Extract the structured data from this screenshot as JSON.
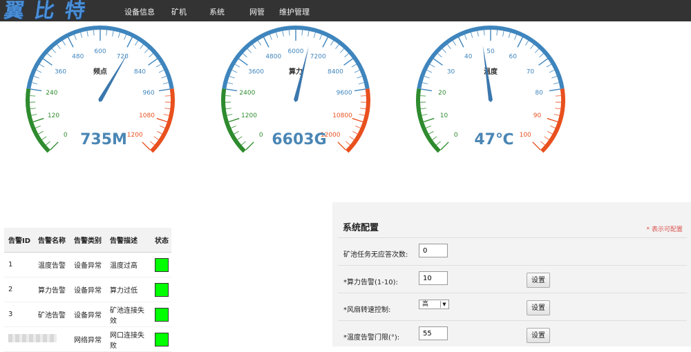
{
  "header": {
    "logo": "翼比特",
    "nav": [
      "设备信息",
      "矿机",
      "系统",
      "网管",
      "维护管理"
    ]
  },
  "gauges": [
    {
      "title": "频点",
      "value": 735,
      "value_label": "735M",
      "min": 0,
      "max": 1200,
      "ticks": [
        "0",
        "120",
        "240",
        "360",
        "480",
        "600",
        "720",
        "840",
        "960",
        "1080",
        "1200"
      ]
    },
    {
      "title": "算力",
      "value": 6603,
      "value_label": "6603G",
      "min": 0,
      "max": 12000,
      "ticks": [
        "0",
        "1200",
        "2400",
        "3600",
        "4800",
        "6000",
        "7200",
        "8400",
        "9600",
        "10800",
        "12000"
      ]
    },
    {
      "title": "温度",
      "value": 47,
      "value_label": "47℃",
      "min": 0,
      "max": 100,
      "ticks": [
        "0",
        "10",
        "20",
        "30",
        "40",
        "50",
        "60",
        "70",
        "80",
        "90",
        "100"
      ]
    }
  ],
  "colors": {
    "low": "#2e8b2e",
    "mid": "#3f85bd",
    "high": "#e8501e",
    "status_ok": "#00ff00"
  },
  "alarms": {
    "headers": [
      "告警ID",
      "告警名称",
      "告警类别",
      "告警描述",
      "状态"
    ],
    "rows": [
      {
        "id": "1",
        "name": "温度告警",
        "type": "设备异常",
        "desc": "温度过高"
      },
      {
        "id": "2",
        "name": "算力告警",
        "type": "设备异常",
        "desc": "算力过低"
      },
      {
        "id": "3",
        "name": "矿池告警",
        "type": "设备异常",
        "desc": "矿池连接失效"
      },
      {
        "id": "",
        "name": "",
        "type": "网络异常",
        "desc": "网口连接失败"
      }
    ]
  },
  "config": {
    "title": "系统配置",
    "note": "* 表示可配置",
    "rows": [
      {
        "label": "矿池任务无应答次数:",
        "value": "0"
      },
      {
        "label": "*算力告警(1-10):",
        "value": "10",
        "button": "设置"
      },
      {
        "label": "*风扇转速控制:",
        "select": "高",
        "button": "设置"
      },
      {
        "label": "*温度告警门限(°):",
        "value": "55",
        "button": "设置"
      }
    ]
  }
}
